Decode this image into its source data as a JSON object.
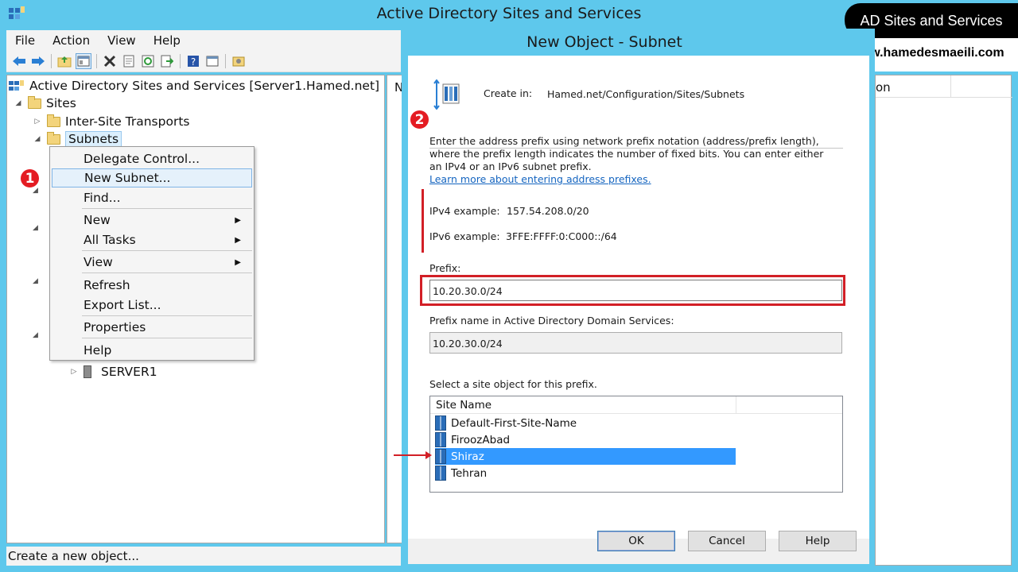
{
  "window": {
    "title": "Active Directory Sites and Services"
  },
  "menu": [
    "File",
    "Action",
    "View",
    "Help"
  ],
  "toolbar_icons": [
    "back-arrow-icon",
    "forward-arrow-icon",
    "up-folder-icon",
    "show-hide-tree-icon",
    "delete-icon",
    "properties-icon",
    "refresh-icon",
    "export-list-icon",
    "help-icon",
    "console-icon",
    "new-object-icon"
  ],
  "tree": {
    "root": "Active Directory Sites and Services [Server1.Hamed.net]",
    "sites": "Sites",
    "inter_site": "Inter-Site Transports",
    "subnets": "Subnets",
    "server": "SERVER1"
  },
  "right_pane_header": "N",
  "context_menu": {
    "items": [
      "Delegate Control...",
      "New Subnet...",
      "Find...",
      "New",
      "All Tasks",
      "View",
      "Refresh",
      "Export List...",
      "Properties",
      "Help"
    ],
    "highlighted": "New Subnet..."
  },
  "badges": {
    "one": "1",
    "two": "2"
  },
  "status": "Create a new object...",
  "far_right_header": "on",
  "watermark": {
    "line1": "AD Sites and Services",
    "line2": "www.hamedesmaeili.com"
  },
  "dialog": {
    "title": "New Object - Subnet",
    "create_in_label": "Create in:",
    "create_in_value": "Hamed.net/Configuration/Sites/Subnets",
    "instructions_1": "Enter the address prefix using network prefix notation (address/prefix length),",
    "instructions_2": "where the prefix length indicates the number of fixed bits. You can enter either",
    "instructions_3": "an IPv4 or an IPv6 subnet prefix.",
    "learn_more": "Learn more about entering address prefixes.",
    "ipv4_label": "IPv4 example:",
    "ipv4_value": "157.54.208.0/20",
    "ipv6_label": "IPv6 example:",
    "ipv6_value": "3FFE:FFFF:0:C000::/64",
    "prefix_label": "Prefix:",
    "prefix_value": "10.20.30.0/24",
    "prefix_name_label": "Prefix name in Active Directory Domain Services:",
    "prefix_name_value": "10.20.30.0/24",
    "site_select_label": "Select a site object for this prefix.",
    "site_column": "Site Name",
    "sites": [
      "Default-First-Site-Name",
      "FiroozAbad",
      "Shiraz",
      "Tehran"
    ],
    "selected_site": "Shiraz",
    "buttons": {
      "ok": "OK",
      "cancel": "Cancel",
      "help": "Help"
    }
  },
  "colors": {
    "accent": "#5ec8ec",
    "highlight": "#3399ff",
    "annotation_red": "#d21f26"
  }
}
